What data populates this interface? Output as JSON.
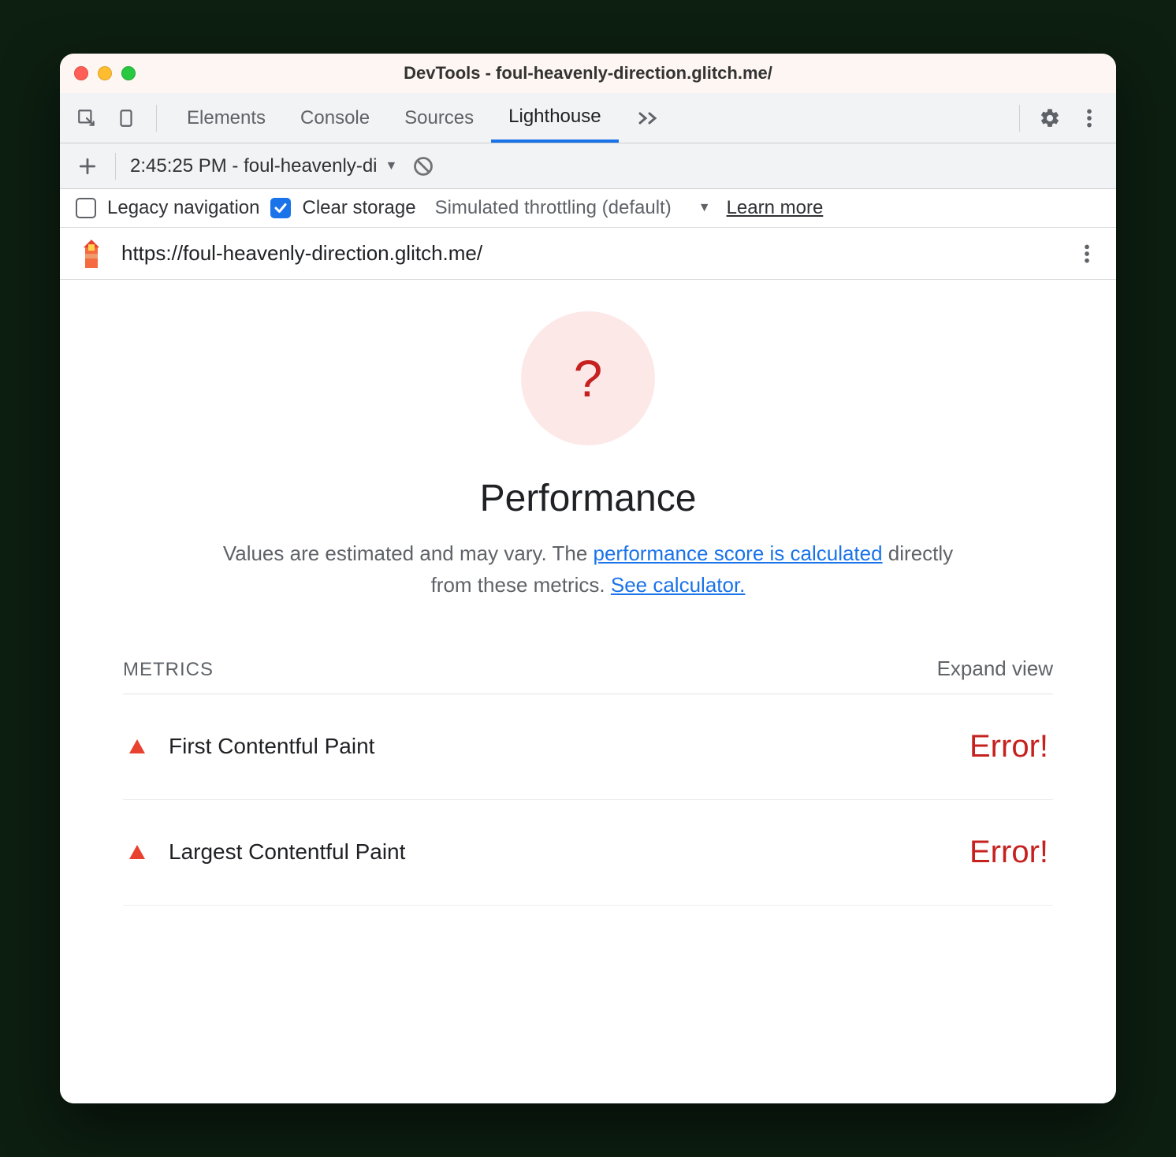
{
  "window": {
    "title": "DevTools - foul-heavenly-direction.glitch.me/"
  },
  "tabs": {
    "items": [
      "Elements",
      "Console",
      "Sources",
      "Lighthouse"
    ],
    "active": "Lighthouse"
  },
  "subbar": {
    "selected_run": "2:45:25 PM - foul-heavenly-di"
  },
  "checkbar": {
    "legacy_label": "Legacy navigation",
    "legacy_checked": false,
    "clear_label": "Clear storage",
    "clear_checked": true,
    "throttling_label": "Simulated throttling (default)",
    "learn_more": "Learn more"
  },
  "urlbar": {
    "url": "https://foul-heavenly-direction.glitch.me/"
  },
  "report": {
    "score_symbol": "?",
    "category": "Performance",
    "desc_prefix": "Values are estimated and may vary. The ",
    "desc_link1": "performance score is calculated",
    "desc_mid": " directly from these metrics. ",
    "desc_link2": "See calculator.",
    "metrics_label": "METRICS",
    "expand_label": "Expand view"
  },
  "metrics": [
    {
      "name": "First Contentful Paint",
      "value": "Error!"
    },
    {
      "name": "Largest Contentful Paint",
      "value": "Error!"
    }
  ]
}
